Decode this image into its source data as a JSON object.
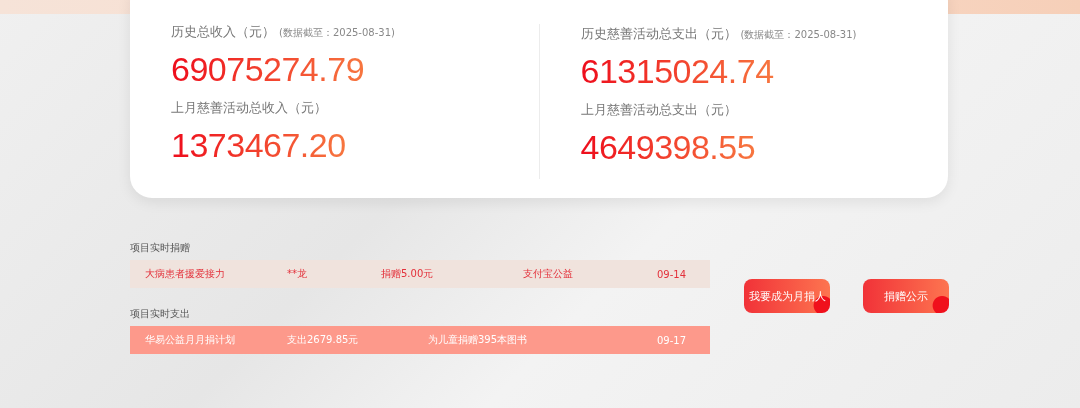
{
  "stats": [
    {
      "label": "历史总收入（元）",
      "note": "(数据截至：2025-08-31)",
      "value": "69075274.79",
      "sub_label": "上月慈善活动总收入（元）",
      "sub_value": "1373467.20"
    },
    {
      "label": "历史慈善活动总支出（元）",
      "note": "(数据截至：2025-08-31)",
      "value": "61315024.74",
      "sub_label": "上月慈善活动总支出（元）",
      "sub_value": "4649398.55"
    }
  ],
  "feeds": [
    {
      "title": "项目实时捐赠",
      "kind": "donation",
      "cells": [
        "大病患者援爱接力",
        "**龙",
        "捐赠5.00元",
        "支付宝公益",
        "09-14"
      ]
    },
    {
      "title": "项目实时支出",
      "kind": "expense",
      "cells": [
        "华易公益月月捐计划",
        "支出2679.85元",
        "为儿童捐赠395本图书",
        "09-17"
      ]
    }
  ],
  "buttons": [
    "我要成为月捐人",
    "捐赠公示"
  ]
}
